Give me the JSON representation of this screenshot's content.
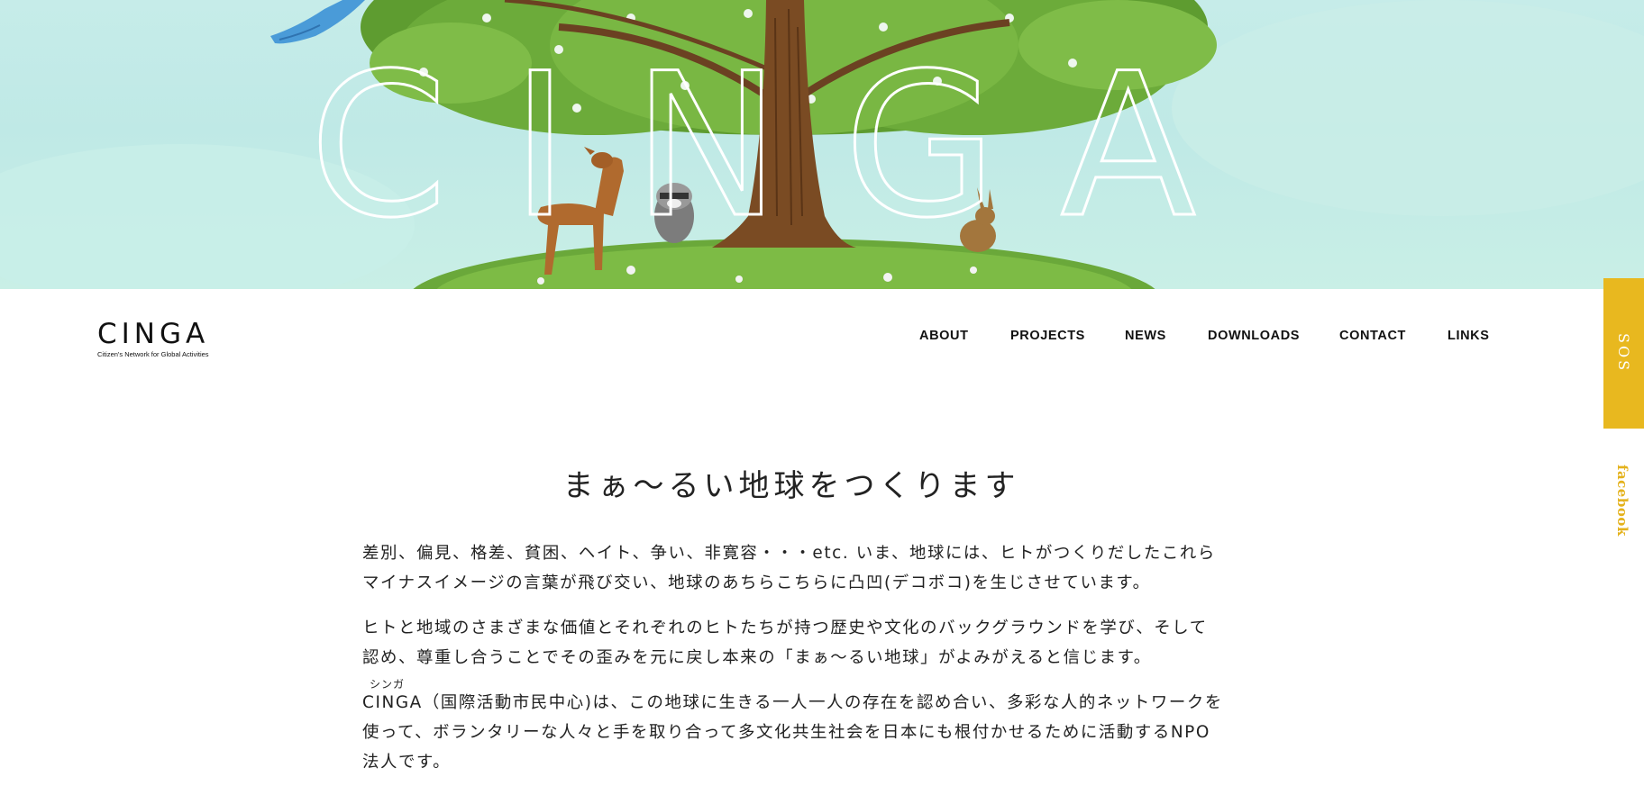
{
  "hero": {
    "title_outline": "CINGA"
  },
  "header": {
    "logo": {
      "main": "CINGA",
      "sub": "Citizen's Network for Global Activities"
    },
    "nav": [
      "ABOUT",
      "PROJECTS",
      "NEWS",
      "DOWNLOADS",
      "CONTACT",
      "LINKS"
    ]
  },
  "side": {
    "sos_label": "SOS",
    "facebook_label": "facebook",
    "colors": {
      "sos_bg": "#e8b81f",
      "facebook_text": "#e4b21c"
    }
  },
  "main": {
    "heading": "まぁ〜るい地球をつくります",
    "paragraphs": [
      "差別、偏見、格差、貧困、ヘイト、争い、非寛容・・・etc. いま、地球には、ヒトがつくりだしたこれらマイナスイメージの言葉が飛び交い、地球のあちらこちらに凸凹(デコボコ)を生じさせています。",
      "ヒトと地域のさまざまな価値とそれぞれのヒトたちが持つ歴史や文化のバックグラウンドを学び、そして認め、尊重し合うことでその歪みを元に戻し本来の「まぁ〜るい地球」がよみがえると信じます。",
      "CINGA（国際活動市民中心)は、この地球に生きる一人一人の存在を認め合い、多彩な人的ネットワークを使って、ボランタリーな人々と手を取り合って多文化共生社会を日本にも根付かせるために活動するNPO法人です。"
    ],
    "ruby": "シンガ"
  }
}
